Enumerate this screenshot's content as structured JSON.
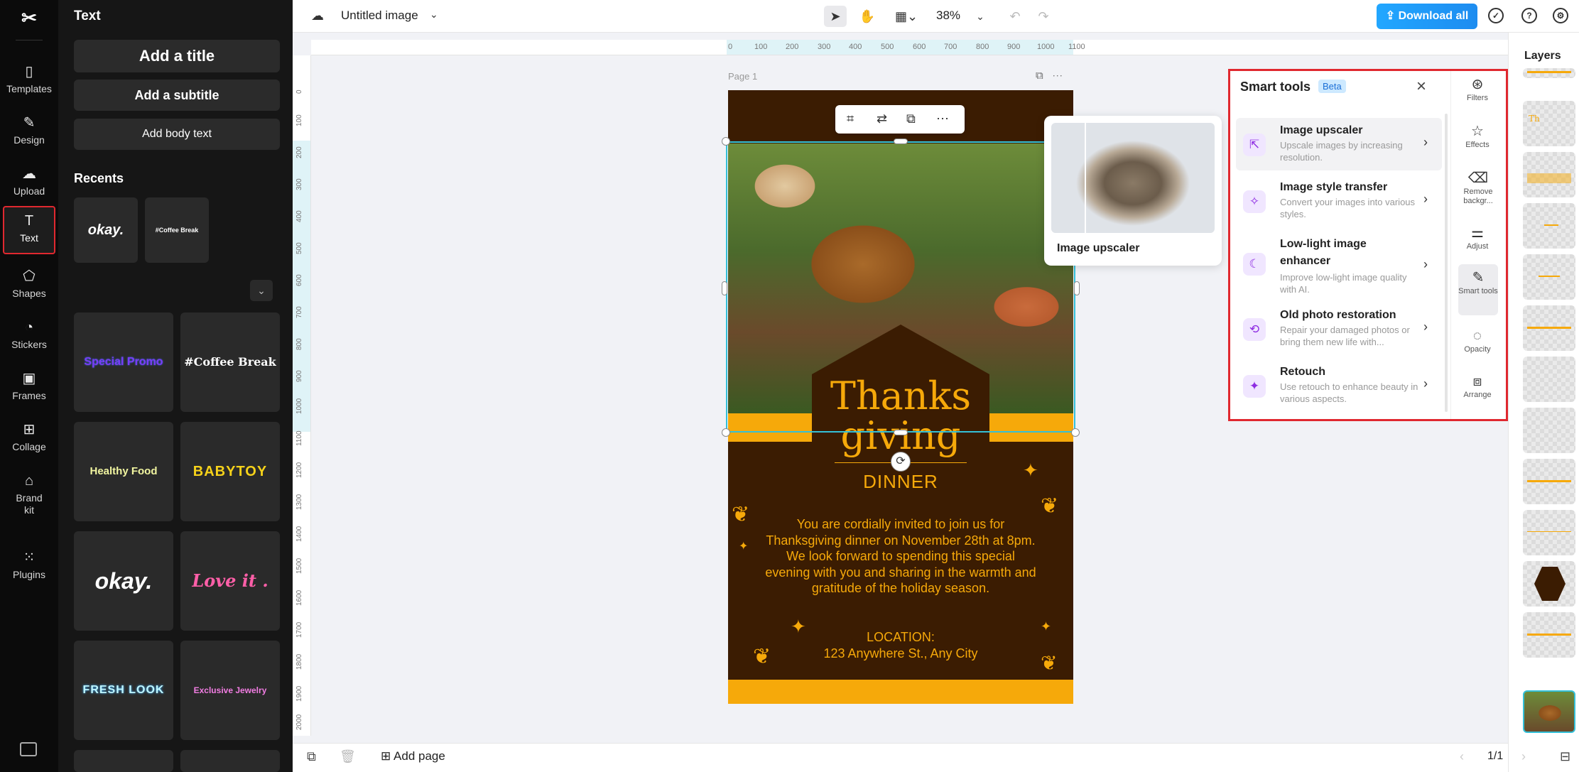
{
  "app": {
    "doc_title": "Untitled image",
    "zoom": "38%",
    "download_label": "Download all"
  },
  "rail": [
    {
      "label": "Templates",
      "icon": "templates-icon"
    },
    {
      "label": "Design",
      "icon": "design-icon"
    },
    {
      "label": "Upload",
      "icon": "upload-icon"
    },
    {
      "label": "Text",
      "icon": "text-icon"
    },
    {
      "label": "Shapes",
      "icon": "shapes-icon"
    },
    {
      "label": "Stickers",
      "icon": "stickers-icon"
    },
    {
      "label": "Frames",
      "icon": "frames-icon"
    },
    {
      "label": "Collage",
      "icon": "collage-icon"
    },
    {
      "label": "Brand kit",
      "icon": "brand-kit-icon"
    },
    {
      "label": "Plugins",
      "icon": "plugins-icon"
    }
  ],
  "text_panel": {
    "title": "Text",
    "add_title": "Add a title",
    "add_subtitle": "Add a subtitle",
    "add_body": "Add body text",
    "recents_title": "Recents",
    "recents": [
      "okay.",
      "#Coffee Break"
    ],
    "presets": [
      "Special Promo",
      "#Coffee Break",
      "Healthy Food",
      "BABYTOY",
      "okay.",
      "Love it .",
      "FRESH LOOK",
      "Exclusive Jewelry"
    ]
  },
  "canvas": {
    "page_label": "Page 1",
    "ruler_top": [
      "0",
      "100",
      "200",
      "300",
      "400",
      "500",
      "600",
      "700",
      "800",
      "900",
      "1000",
      "1100"
    ],
    "ruler_left": [
      "0",
      "100",
      "200",
      "300",
      "400",
      "500",
      "600",
      "700",
      "800",
      "900",
      "1000",
      "1100",
      "1200",
      "1300",
      "1400",
      "1500",
      "1600",
      "1700",
      "1800",
      "1900",
      "2000"
    ],
    "poster": {
      "title_line1": "Thanks",
      "title_line2": "giving",
      "subtitle": "DINNER",
      "invite": "You are cordially invited to join us for Thanksgiving dinner on November 28th at 8pm. We look forward to spending this special evening with you and sharing in the warmth and gratitude of the holiday season.",
      "location_label": "LOCATION:",
      "address": "123 Anywhere St., Any City"
    }
  },
  "preview": {
    "label": "Image upscaler"
  },
  "smart_tools": {
    "title": "Smart tools",
    "badge": "Beta",
    "items": [
      {
        "name": "Image upscaler",
        "desc": "Upscale images by increasing resolution."
      },
      {
        "name": "Image style transfer",
        "desc": "Convert your images into various styles."
      },
      {
        "name": "Low-light image enhancer",
        "desc": "Improve low-light image quality with AI."
      },
      {
        "name": "Old photo restoration",
        "desc": "Repair your damaged photos or bring them new life with..."
      },
      {
        "name": "Retouch",
        "desc": "Use retouch to enhance beauty in various aspects."
      }
    ],
    "side": [
      "Filters",
      "Effects",
      "Remove backgr...",
      "Adjust",
      "Smart tools",
      "Opacity",
      "Arrange"
    ]
  },
  "layers": {
    "title": "Layers"
  },
  "bottom": {
    "add_page": "Add page",
    "page_count": "1/1"
  }
}
